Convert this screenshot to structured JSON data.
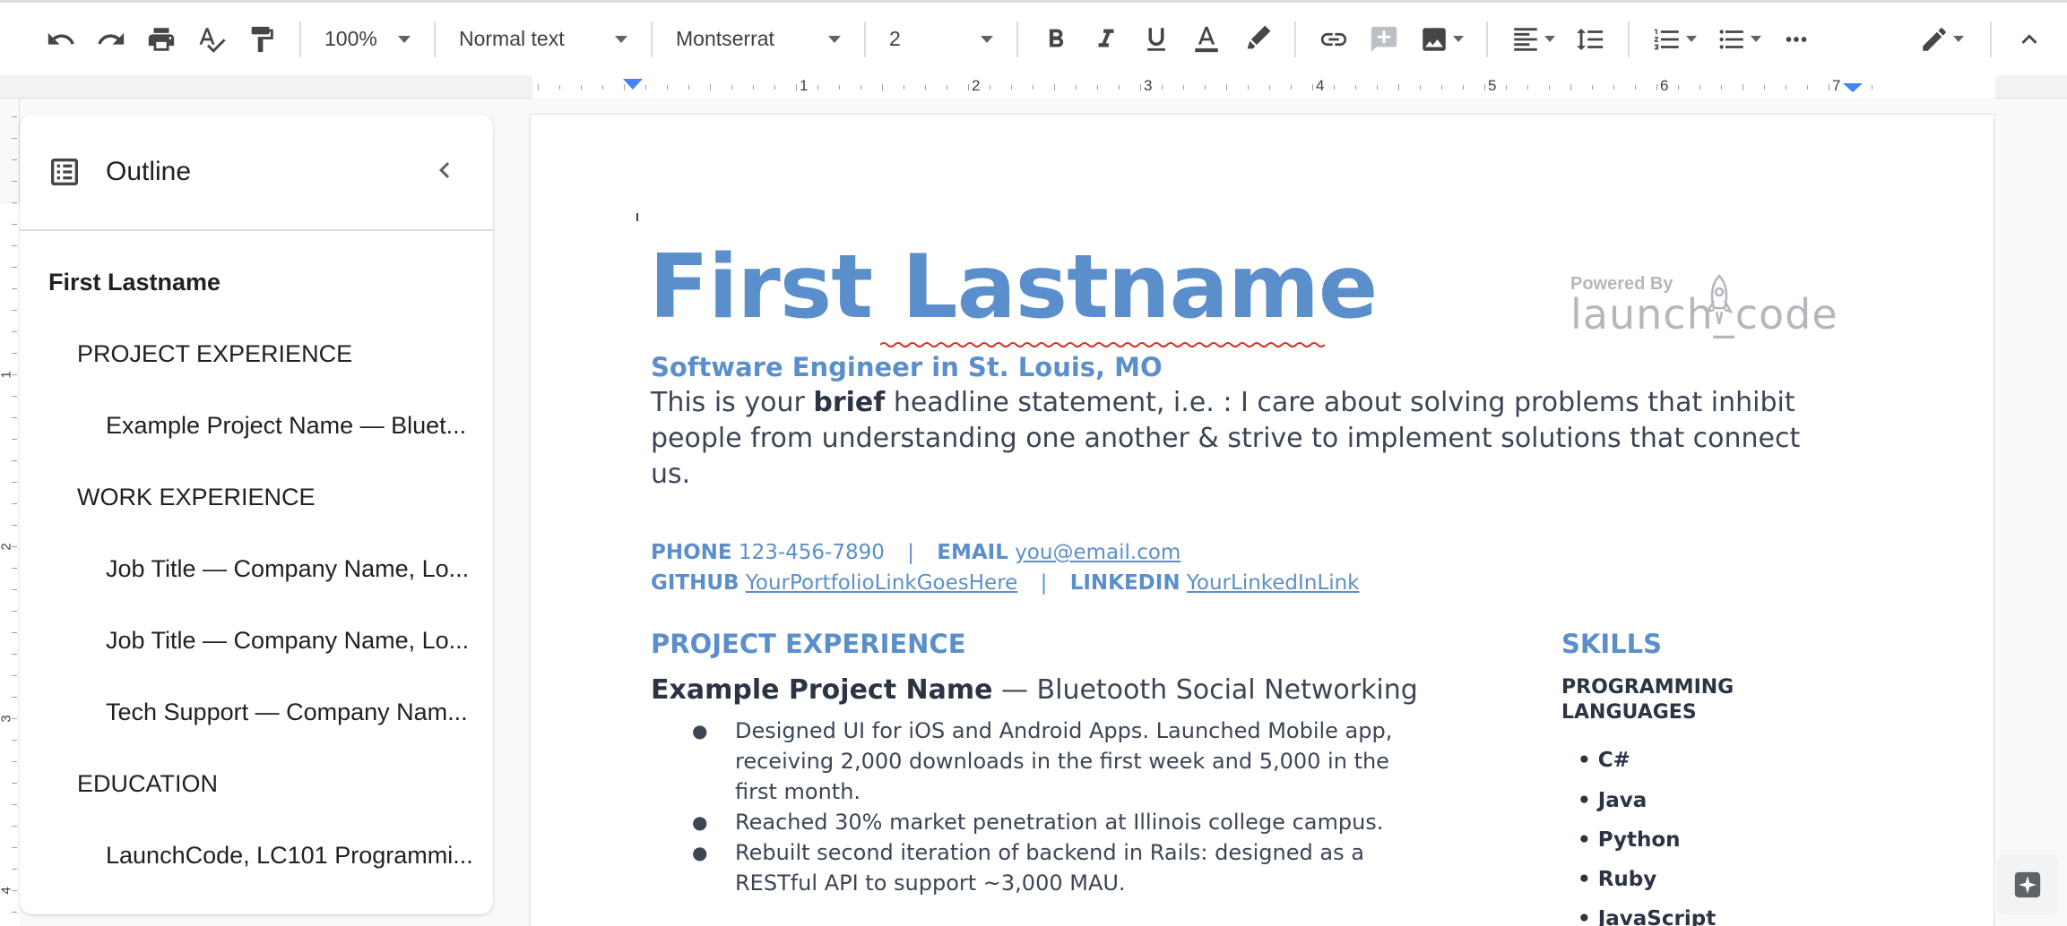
{
  "toolbar": {
    "zoom": "100%",
    "style": "Normal text",
    "font": "Montserrat",
    "font_size": "2"
  },
  "ruler": {
    "numbers": [
      "1",
      "2",
      "3",
      "4",
      "5",
      "6",
      "7"
    ]
  },
  "vruler": {
    "numbers": [
      "1",
      "2",
      "3",
      "4"
    ]
  },
  "outline": {
    "title": "Outline",
    "items": [
      {
        "label": "First Lastname",
        "level": 1
      },
      {
        "label": "PROJECT EXPERIENCE",
        "level": 2
      },
      {
        "label": "Example Project Name — Bluet...",
        "level": 3
      },
      {
        "label": "WORK EXPERIENCE",
        "level": 2
      },
      {
        "label": "Job Title — Company Name, Lo...",
        "level": 3
      },
      {
        "label": "Job Title — Company Name, Lo...",
        "level": 3
      },
      {
        "label": "Tech Support — Company Nam...",
        "level": 3
      },
      {
        "label": "EDUCATION",
        "level": 2
      },
      {
        "label": "LaunchCode, LC101 Programmi...",
        "level": 3
      }
    ]
  },
  "doc": {
    "name": "First Lastname",
    "powered_by": "Powered By",
    "brand": "launch_code",
    "subtitle": "Software Engineer in St. Louis, MO",
    "headline_pre": "This is your ",
    "headline_bold": "brief",
    "headline_post": " headline statement, i.e. : I care about solving problems that inhibit people from understanding one another & strive to implement solutions that connect us.",
    "phone_label": "PHONE",
    "phone": "123-456-7890",
    "email_label": "EMAIL",
    "email": "you@email.com",
    "github_label": "GITHUB",
    "github": "YourPortfolioLinkGoesHere",
    "linkedin_label": "LINKEDIN",
    "linkedin": "YourLinkedInLink",
    "separator": "|",
    "project_heading": "PROJECT EXPERIENCE",
    "project_name": "Example Project Name",
    "project_desc": " — Bluetooth Social Networking",
    "bullets": [
      "Designed UI for iOS and Android Apps. Launched Mobile app, receiving 2,000 downloads in the first week and 5,000 in the first month.",
      "Reached 30% market penetration at Illinois college campus.",
      "Rebuilt second iteration of backend in Rails: designed as a RESTful API to support ~3,000 MAU."
    ],
    "skills_heading": "SKILLS",
    "skills_sub": "PROGRAMMING LANGUAGES",
    "skills": [
      "• C#",
      "• Java",
      "• Python",
      "• Ruby",
      "• JavaScript"
    ]
  },
  "colors": {
    "accent": "#5b8fcb",
    "dark_text": "#2c3444",
    "body_text": "#3d4555",
    "ruler_marker": "#4285f4"
  }
}
